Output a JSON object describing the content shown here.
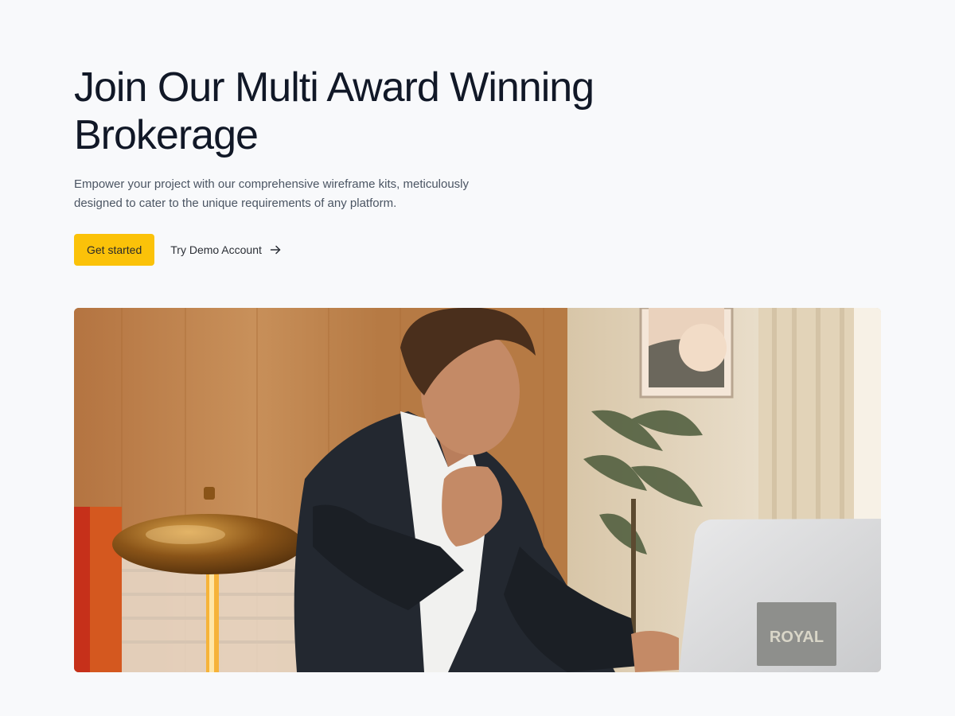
{
  "hero": {
    "title": "Join Our Multi Award Winning Brokerage",
    "subtitle": "Empower your project with our comprehensive wireframe kits, meticulously designed to cater to the unique requirements of any platform.",
    "primary_cta": "Get started",
    "secondary_cta": "Try Demo Account",
    "secondary_cta_icon": "arrow-right-icon"
  },
  "photo": {
    "laptop_logo": "ROYAL"
  },
  "colors": {
    "background": "#f8f9fb",
    "accent": "#fbc209",
    "heading": "#111827",
    "body_text": "#4b5563"
  }
}
